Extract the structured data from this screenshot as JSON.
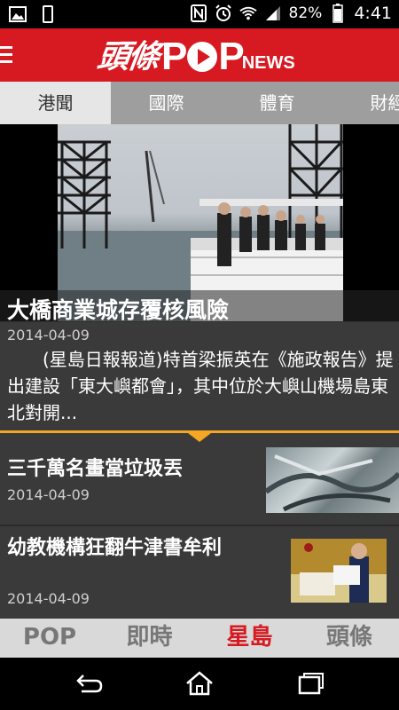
{
  "status_bar": {
    "battery_percent": "82%",
    "time": "4:41",
    "left_icons": [
      "image-notification-icon",
      "phone-icon"
    ],
    "right_icons": [
      "nfc-icon",
      "alarm-icon",
      "wifi-icon",
      "signal-icon",
      "battery-icon"
    ]
  },
  "header": {
    "logo_cn": "頭條",
    "logo_pop": "POP",
    "logo_news": "NEWS"
  },
  "tabs": [
    {
      "label": "港聞",
      "active": true
    },
    {
      "label": "國際",
      "active": false
    },
    {
      "label": "體育",
      "active": false
    },
    {
      "label": "財經",
      "active": false
    }
  ],
  "hero": {
    "title": "大橋商業城存覆核風險",
    "date": "2014-04-09",
    "summary": "(星島日報報道)特首梁振英在《施政報告》提出建設「東大嶼都會」，其中位於大嶼山機場島東北對開..."
  },
  "news_items": [
    {
      "title": "三千萬名畫當垃圾丟",
      "date": "2014-04-09"
    },
    {
      "title": "幼教機構狂翻牛津書牟利",
      "date": "2014-04-09"
    }
  ],
  "bottom_nav": [
    {
      "label": "POP",
      "active": false
    },
    {
      "label": "即時",
      "active": false
    },
    {
      "label": "星島",
      "active": true
    },
    {
      "label": "頭條",
      "active": false
    }
  ],
  "colors": {
    "brand_red": "#d71921",
    "accent_orange": "#f5a623"
  }
}
